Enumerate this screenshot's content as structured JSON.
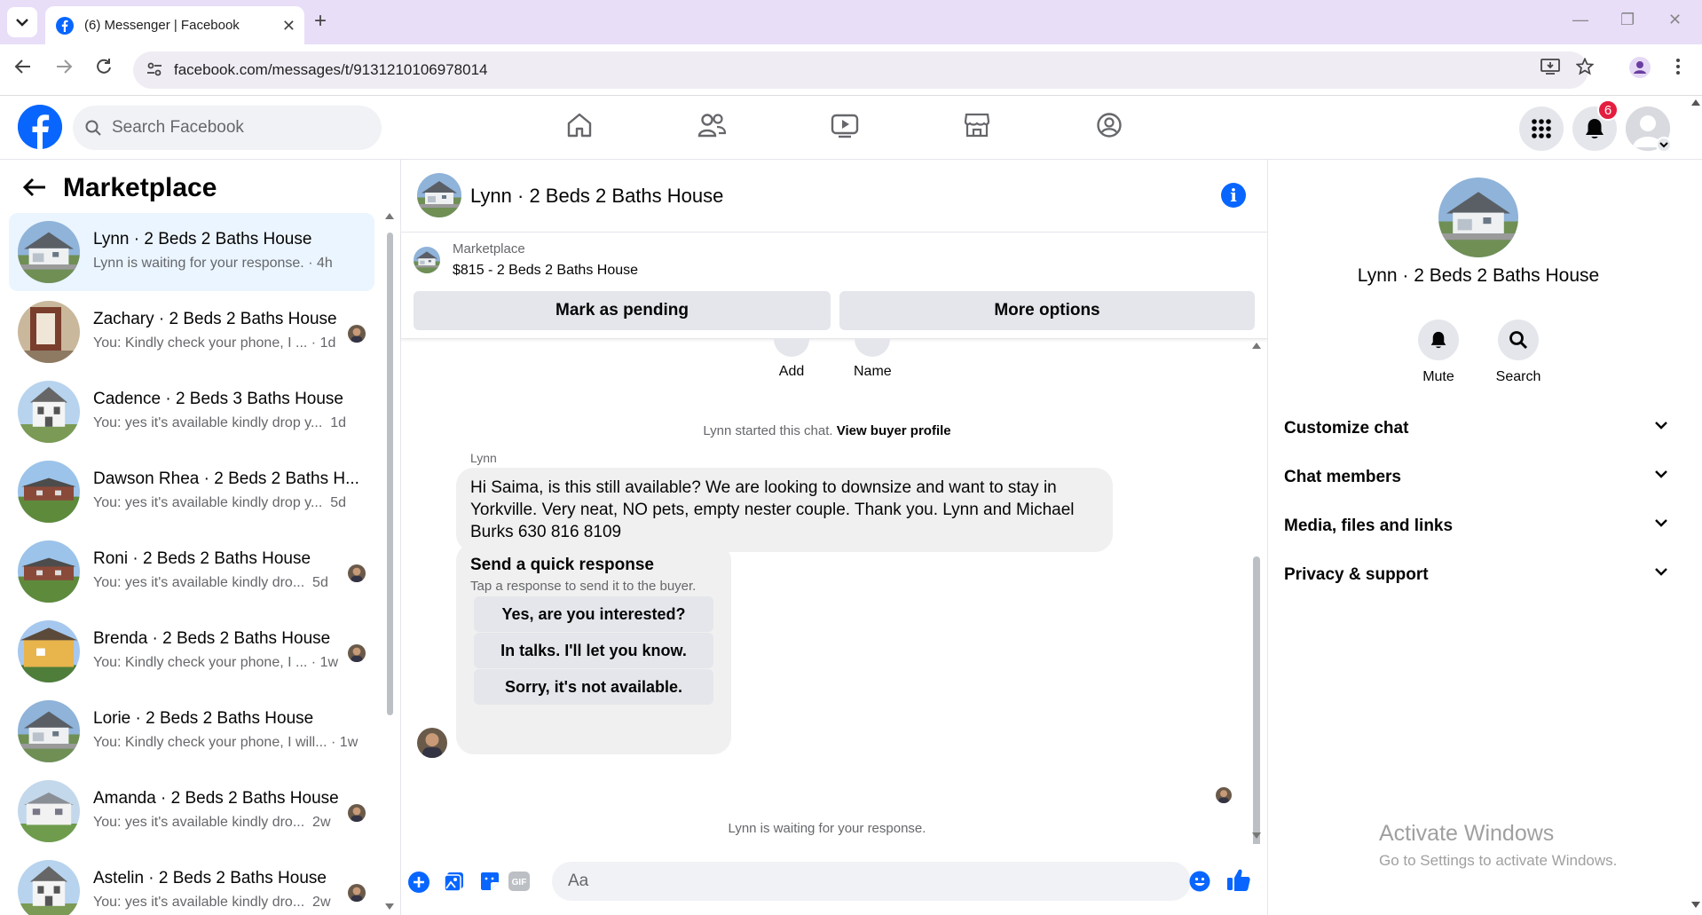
{
  "browser": {
    "tab_title": "(6) Messenger | Facebook",
    "url": "facebook.com/messages/t/9131210106978014"
  },
  "fb": {
    "search_placeholder": "Search Facebook",
    "notification_count": "6",
    "accent_color": "#0866ff"
  },
  "sidebar": {
    "title": "Marketplace",
    "conversations": [
      {
        "name": "Lynn · 2 Beds 2 Baths House",
        "preview": "Lynn is waiting for your response.",
        "time": "· 4h",
        "active": true
      },
      {
        "name": "Zachary · 2 Beds 2 Baths House",
        "preview": "You: Kindly check your phone, I ...",
        "time": "· 1d"
      },
      {
        "name": "Cadence · 2 Beds 3 Baths House",
        "preview": "You: yes it's available kindly drop y...",
        "time": "1d"
      },
      {
        "name": "Dawson Rhea · 2 Beds 2 Baths H...",
        "preview": "You: yes it's available kindly drop y...",
        "time": "5d"
      },
      {
        "name": "Roni · 2 Beds 2 Baths House",
        "preview": "You: yes it's available kindly dro...",
        "time": "5d"
      },
      {
        "name": "Brenda · 2 Beds 2 Baths House",
        "preview": "You: Kindly check your phone, I ...",
        "time": "· 1w"
      },
      {
        "name": "Lorie · 2 Beds 2 Baths House",
        "preview": "You: Kindly check your phone, I will...",
        "time": "· 1w"
      },
      {
        "name": "Amanda · 2 Beds 2 Baths House",
        "preview": "You: yes it's available kindly dro...",
        "time": "2w"
      },
      {
        "name": "Astelin · 2 Beds 2 Baths House",
        "preview": "You: yes it's available kindly dro...",
        "time": "2w"
      }
    ]
  },
  "chat": {
    "title": "Lynn · 2 Beds 2 Baths House",
    "marketplace_label": "Marketplace",
    "listing": "$815 - 2 Beds 2 Baths House",
    "mark_pending": "Mark as pending",
    "more_options": "More options",
    "tool_add": "Add",
    "tool_name": "Name",
    "started_text": "Lynn started this chat.",
    "view_profile": "View buyer profile",
    "sender": "Lynn",
    "message": "Hi Saima, is this still available?  We are looking to downsize and want to stay in Yorkville.   Very neat, NO pets, empty nester couple.  Thank you.  Lynn and Michael Burks 630 816 8109",
    "quick_title": "Send a quick response",
    "quick_sub": "Tap a response to send it to the buyer.",
    "quick_options": [
      "Yes, are you interested?",
      "In talks. I'll let you know.",
      "Sorry, it's not available."
    ],
    "waiting": "Lynn is waiting for your response.",
    "composer_placeholder": "Aa"
  },
  "rpanel": {
    "name": "Lynn · 2 Beds 2 Baths House",
    "mute": "Mute",
    "search": "Search",
    "sections": [
      "Customize chat",
      "Chat members",
      "Media, files and links",
      "Privacy & support"
    ]
  },
  "os": {
    "watermark_title": "Activate Windows",
    "watermark_sub": "Go to Settings to activate Windows."
  }
}
